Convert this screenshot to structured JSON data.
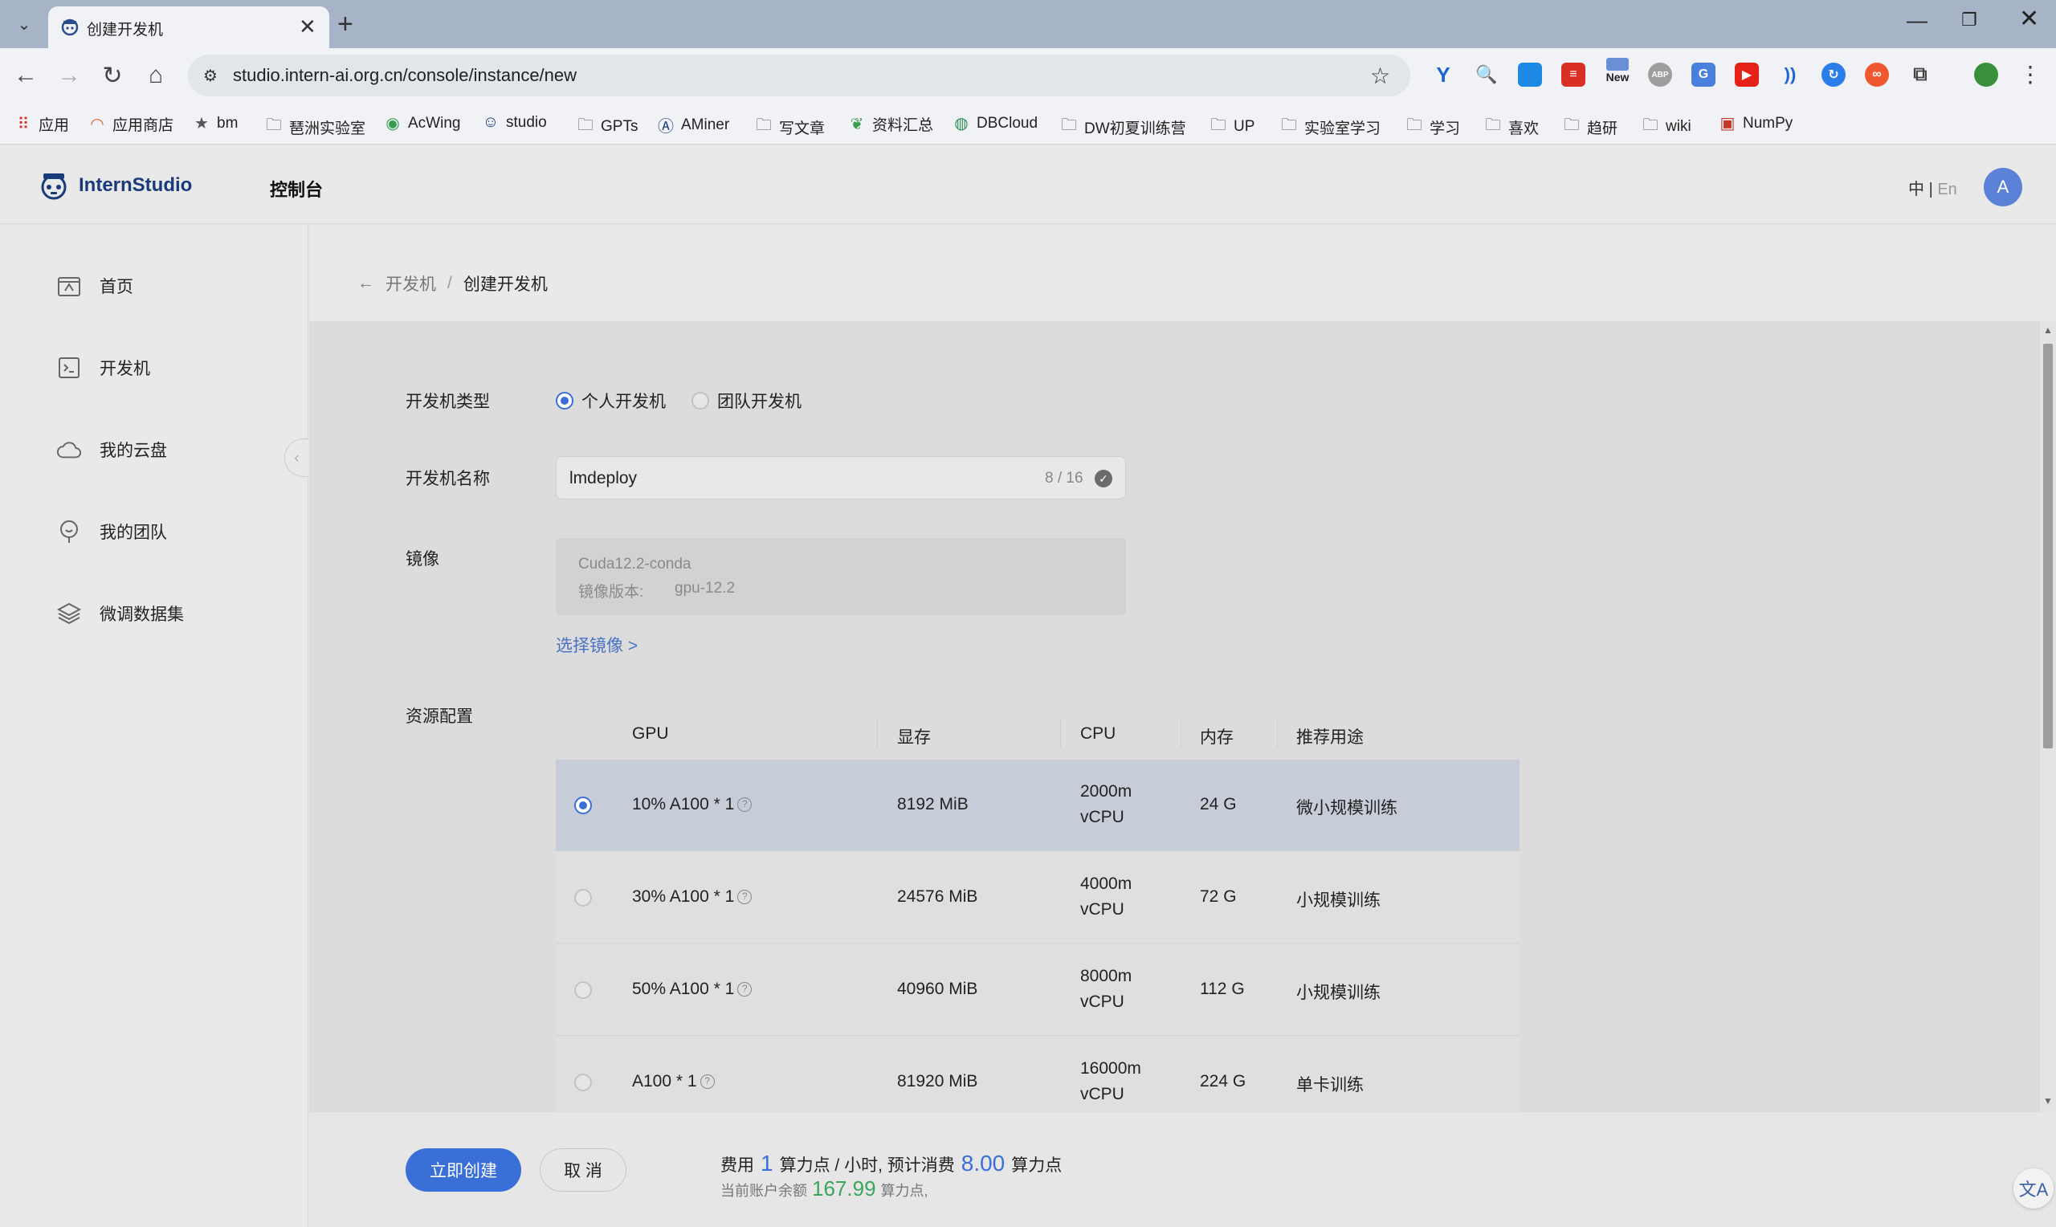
{
  "browser": {
    "tab_title": "创建开发机",
    "tab_close": "✕",
    "new_tab": "+",
    "url": "studio.intern-ai.org.cn/console/instance/new",
    "extension_new_badge": "New"
  },
  "bookmarks": [
    {
      "label": "应用",
      "icon": "apps-grid-icon"
    },
    {
      "label": "应用商店",
      "icon": "rainbow-icon"
    },
    {
      "label": "bm",
      "icon": "star-icon"
    },
    {
      "label": "琶洲实验室",
      "icon": "folder-icon"
    },
    {
      "label": "AcWing",
      "icon": "acwing-icon"
    },
    {
      "label": "studio",
      "icon": "studio-icon"
    },
    {
      "label": "GPTs",
      "icon": "folder-icon"
    },
    {
      "label": "AMiner",
      "icon": "aminer-icon"
    },
    {
      "label": "写文章",
      "icon": "folder-icon"
    },
    {
      "label": "资料汇总",
      "icon": "leaf-icon"
    },
    {
      "label": "DBCloud",
      "icon": "dbcloud-icon"
    },
    {
      "label": "DW初夏训练营",
      "icon": "folder-icon"
    },
    {
      "label": "UP",
      "icon": "folder-icon"
    },
    {
      "label": "实验室学习",
      "icon": "folder-icon"
    },
    {
      "label": "学习",
      "icon": "folder-icon"
    },
    {
      "label": "喜欢",
      "icon": "folder-icon"
    },
    {
      "label": "趋研",
      "icon": "folder-icon"
    },
    {
      "label": "wiki",
      "icon": "folder-icon"
    },
    {
      "label": "NumPy",
      "icon": "numpy-icon"
    }
  ],
  "header": {
    "logo_text": "InternStudio",
    "console_title": "控制台",
    "lang_zh": "中",
    "lang_sep": "|",
    "lang_en": "En",
    "avatar_letter": "A"
  },
  "sidebar": {
    "items": [
      {
        "label": "首页",
        "icon": "home-icon"
      },
      {
        "label": "开发机",
        "icon": "terminal-icon"
      },
      {
        "label": "我的云盘",
        "icon": "cloud-icon"
      },
      {
        "label": "我的团队",
        "icon": "team-icon"
      },
      {
        "label": "微调数据集",
        "icon": "layers-icon"
      }
    ]
  },
  "breadcrumb": {
    "back_arrow": "←",
    "parent": "开发机",
    "separator": "/",
    "current": "创建开发机"
  },
  "form": {
    "type_label": "开发机类型",
    "type_options": [
      "个人开发机",
      "团队开发机"
    ],
    "type_selected": "个人开发机",
    "name_label": "开发机名称",
    "name_value": "lmdeploy",
    "name_count": "8 / 16",
    "image_label": "镜像",
    "image_name": "Cuda12.2-conda",
    "image_version_label": "镜像版本:",
    "image_version": "gpu-12.2",
    "choose_image": "选择镜像 >",
    "resource_label": "资源配置"
  },
  "resource_table": {
    "headers": [
      "GPU",
      "显存",
      "CPU",
      "内存",
      "推荐用途"
    ],
    "rows": [
      {
        "gpu": "10% A100 * 1",
        "vram": "8192 MiB",
        "cpu_line1": "2000m",
        "cpu_line2": "vCPU",
        "mem": "24 G",
        "use": "微小规模训练",
        "selected": true
      },
      {
        "gpu": "30% A100 * 1",
        "vram": "24576 MiB",
        "cpu_line1": "4000m",
        "cpu_line2": "vCPU",
        "mem": "72 G",
        "use": "小规模训练",
        "selected": false
      },
      {
        "gpu": "50% A100 * 1",
        "vram": "40960 MiB",
        "cpu_line1": "8000m",
        "cpu_line2": "vCPU",
        "mem": "112 G",
        "use": "小规模训练",
        "selected": false
      },
      {
        "gpu": "A100 * 1",
        "vram": "81920 MiB",
        "cpu_line1": "16000m",
        "cpu_line2": "vCPU",
        "mem": "224 G",
        "use": "单卡训练",
        "selected": false
      }
    ]
  },
  "footer": {
    "create_button": "立即创建",
    "cancel_button": "取 消",
    "cost_prefix": "费用",
    "cost_value": "1",
    "cost_unit": "算力点 / 小时, 预计消费",
    "estimated_value": "8.00",
    "estimated_unit": "算力点",
    "balance_prefix": "当前账户余额",
    "balance_value": "167.99",
    "balance_unit": "算力点,",
    "translate_glyph": "文A"
  },
  "colors": {
    "primary": "#3b6fd8",
    "balance_green": "#3ba55c",
    "selected_row": "#c6cdd8"
  }
}
